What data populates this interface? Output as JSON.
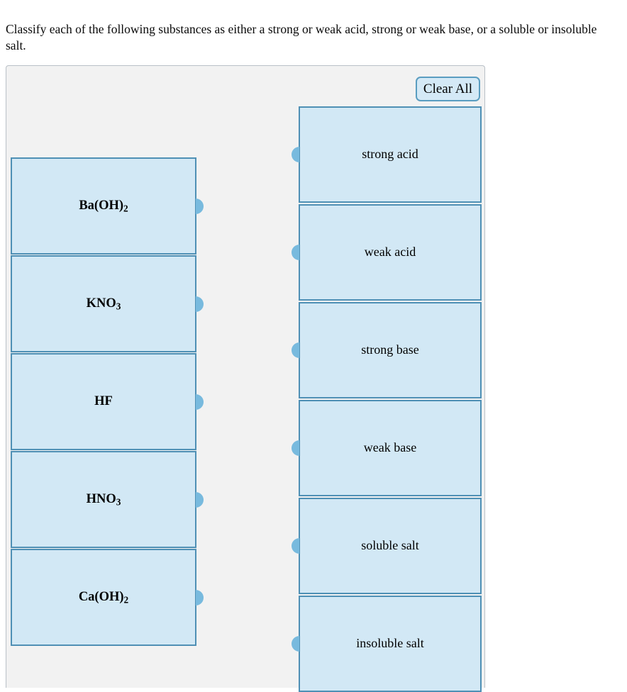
{
  "prompt": "Classify each of the following substances as either a strong or weak acid, strong or weak base, or a soluble or insoluble salt.",
  "toolbar": {
    "clear_all_label": "Clear All"
  },
  "colors": {
    "tile_fill": "#d2e8f5",
    "tile_border": "#4f90b5",
    "knob": "#78bade",
    "panel_background": "#f2f2f2",
    "panel_border": "#b9c0c7",
    "button_fill": "#d4e9f6",
    "button_border": "#5a9dc0"
  },
  "items": [
    {
      "label": "Ba(OH)2",
      "formula_html": "Ba(OH)<sub>2</sub>",
      "name": "substance-ba-oh-2"
    },
    {
      "label": "KNO3",
      "formula_html": "KNO<sub>3</sub>",
      "name": "substance-kno3"
    },
    {
      "label": "HF",
      "formula_html": "HF",
      "name": "substance-hf"
    },
    {
      "label": "HNO3",
      "formula_html": "HNO<sub>3</sub>",
      "name": "substance-hno3"
    },
    {
      "label": "Ca(OH)2",
      "formula_html": "Ca(OH)<sub>2</sub>",
      "name": "substance-ca-oh-2"
    }
  ],
  "categories": [
    {
      "label": "strong acid",
      "name": "category-strong-acid"
    },
    {
      "label": "weak acid",
      "name": "category-weak-acid"
    },
    {
      "label": "strong base",
      "name": "category-strong-base"
    },
    {
      "label": "weak base",
      "name": "category-weak-base"
    },
    {
      "label": "soluble salt",
      "name": "category-soluble-salt"
    },
    {
      "label": "insoluble salt",
      "name": "category-insoluble-salt"
    }
  ]
}
